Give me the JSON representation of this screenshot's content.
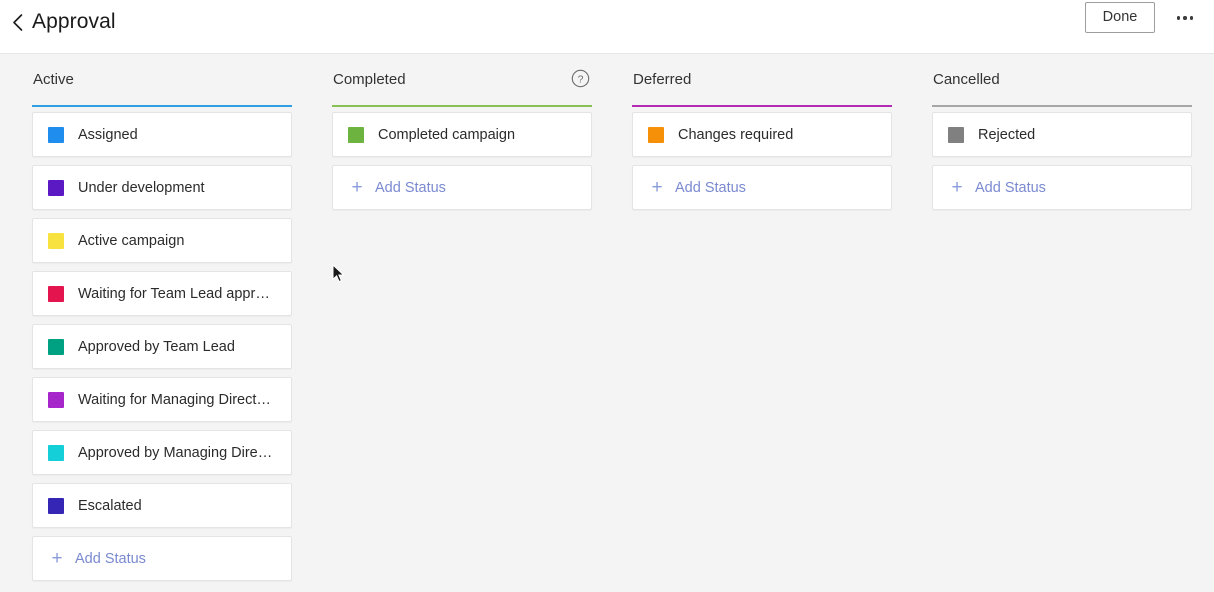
{
  "topbar": {
    "back_icon": "chevron-left-icon",
    "title": "Approval",
    "done_label": "Done",
    "overflow_icon": "ellipsis-icon"
  },
  "board": {
    "columns": [
      {
        "title": "Active",
        "rule_color": "#2f9fe3",
        "has_help_icon": false,
        "help_icon": "",
        "statuses": [
          {
            "label": "Assigned",
            "color": "#1f8ded"
          },
          {
            "label": "Under development",
            "color": "#5b19c4"
          },
          {
            "label": "Active campaign",
            "color": "#f7e23f"
          },
          {
            "label": "Waiting for Team Lead appr…",
            "color": "#e4144f"
          },
          {
            "label": "Approved by Team Lead",
            "color": "#00a083"
          },
          {
            "label": "Waiting for Managing Direct…",
            "color": "#a626cc"
          },
          {
            "label": "Approved by Managing Dire…",
            "color": "#14cfd8"
          },
          {
            "label": "Escalated",
            "color": "#3526b5"
          }
        ],
        "add_label": "Add Status",
        "add_icon": "plus-icon"
      },
      {
        "title": "Completed",
        "rule_color": "#87c156",
        "has_help_icon": true,
        "help_icon": "help-circle-icon",
        "statuses": [
          {
            "label": "Completed campaign",
            "color": "#6cb33f"
          }
        ],
        "add_label": "Add Status",
        "add_icon": "plus-icon"
      },
      {
        "title": "Deferred",
        "rule_color": "#b42bb4",
        "has_help_icon": false,
        "help_icon": "",
        "statuses": [
          {
            "label": "Changes required",
            "color": "#f79009"
          }
        ],
        "add_label": "Add Status",
        "add_icon": "plus-icon"
      },
      {
        "title": "Cancelled",
        "rule_color": "#a6a6a6",
        "has_help_icon": false,
        "help_icon": "",
        "statuses": [
          {
            "label": "Rejected",
            "color": "#808080"
          }
        ],
        "add_label": "Add Status",
        "add_icon": "plus-icon"
      }
    ]
  },
  "cursor": {
    "icon": "mouse-pointer-icon"
  }
}
